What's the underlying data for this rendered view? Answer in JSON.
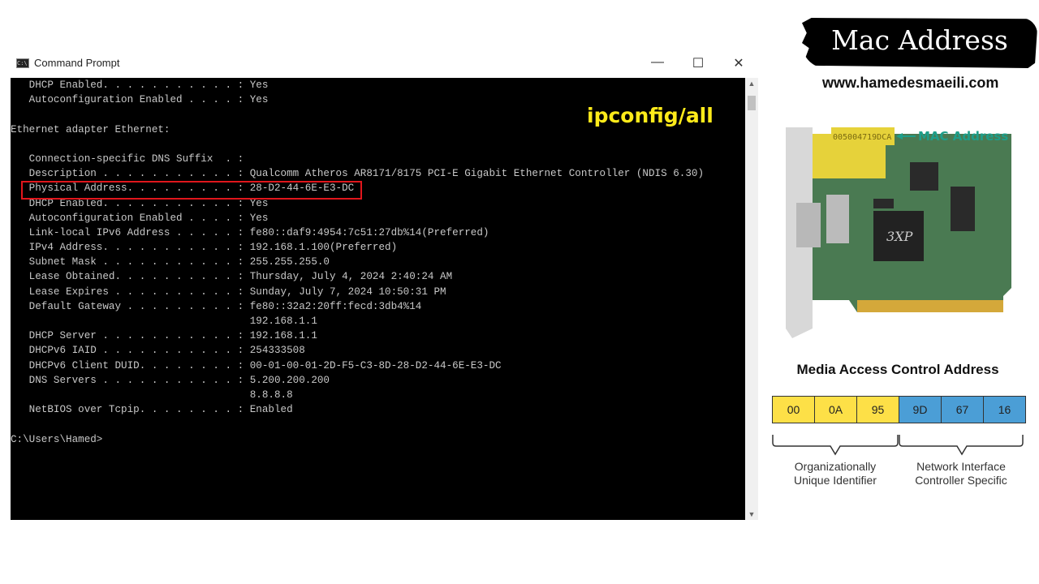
{
  "window": {
    "title": "Command Prompt",
    "icon": "cmd-icon",
    "controls": {
      "minimize": "—",
      "maximize": "☐",
      "close": "✕"
    }
  },
  "terminal": {
    "lines": [
      "   DHCP Enabled. . . . . . . . . . . : Yes",
      "   Autoconfiguration Enabled . . . . : Yes",
      "",
      "Ethernet adapter Ethernet:",
      "",
      "   Connection-specific DNS Suffix  . :",
      "   Description . . . . . . . . . . . : Qualcomm Atheros AR8171/8175 PCI-E Gigabit Ethernet Controller (NDIS 6.30)",
      "   Physical Address. . . . . . . . . : 28-D2-44-6E-E3-DC",
      "   DHCP Enabled. . . . . . . . . . . : Yes",
      "   Autoconfiguration Enabled . . . . : Yes",
      "   Link-local IPv6 Address . . . . . : fe80::daf9:4954:7c51:27db%14(Preferred)",
      "   IPv4 Address. . . . . . . . . . . : 192.168.1.100(Preferred)",
      "   Subnet Mask . . . . . . . . . . . : 255.255.255.0",
      "   Lease Obtained. . . . . . . . . . : Thursday, July 4, 2024 2:40:24 AM",
      "   Lease Expires . . . . . . . . . . : Sunday, July 7, 2024 10:50:31 PM",
      "   Default Gateway . . . . . . . . . : fe80::32a2:20ff:fecd:3db4%14",
      "                                       192.168.1.1",
      "   DHCP Server . . . . . . . . . . . : 192.168.1.1",
      "   DHCPv6 IAID . . . . . . . . . . . : 254333508",
      "   DHCPv6 Client DUID. . . . . . . . : 00-01-00-01-2D-F5-C3-8D-28-D2-44-6E-E3-DC",
      "   DNS Servers . . . . . . . . . . . : 5.200.200.200",
      "                                       8.8.8.8",
      "   NetBIOS over Tcpip. . . . . . . . : Enabled",
      "",
      "C:\\Users\\Hamed>"
    ],
    "command_label": "ipconfig/all",
    "highlight_color": "#e0161c",
    "label_color": "#ffeb1a"
  },
  "side": {
    "banner_title": "Mac Address",
    "website": "www.hamedesmaeili.com",
    "nic_image": {
      "label": "MAC Address",
      "sticker_text": "005004719DCA",
      "chip_text": "3XP"
    },
    "diagram": {
      "title": "Media Access Control Address",
      "octets": [
        {
          "value": "00",
          "color": "#fde047"
        },
        {
          "value": "0A",
          "color": "#fde047"
        },
        {
          "value": "95",
          "color": "#fde047"
        },
        {
          "value": "9D",
          "color": "#4b9ed6"
        },
        {
          "value": "67",
          "color": "#4b9ed6"
        },
        {
          "value": "16",
          "color": "#4b9ed6"
        }
      ],
      "oui_label_1": "Organizationally",
      "oui_label_2": "Unique Identifier",
      "nic_label_1": "Network Interface",
      "nic_label_2": "Controller Specific"
    }
  }
}
